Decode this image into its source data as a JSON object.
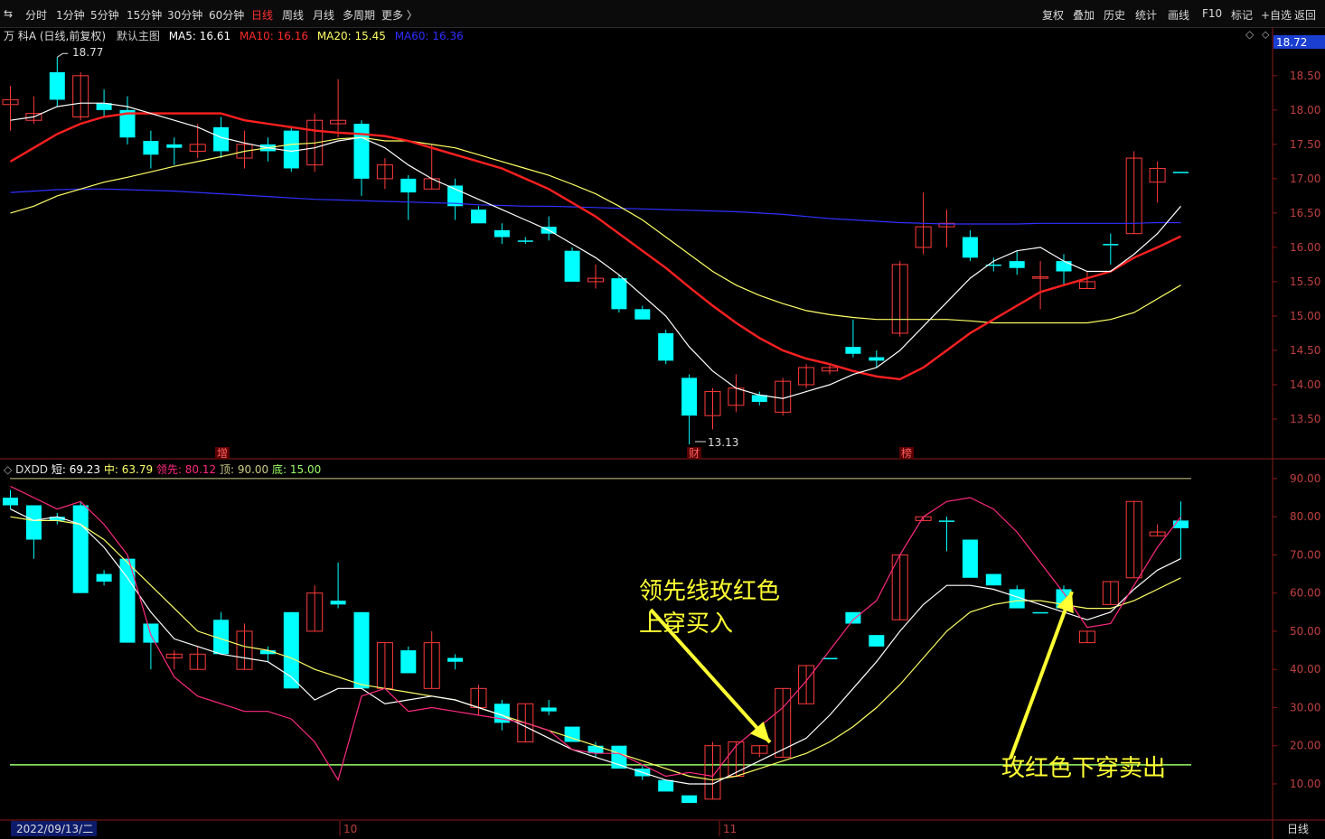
{
  "toolbar": {
    "back_arrow": "⇆",
    "periods": [
      "分时",
      "1分钟",
      "5分钟",
      "15分钟",
      "30分钟",
      "60分钟",
      "日线",
      "周线",
      "月线",
      "多周期",
      "更多 〉"
    ],
    "active_period": "日线",
    "right_items": [
      "复权",
      "叠加",
      "历史",
      "统计",
      "画线",
      "F10",
      "标记",
      "+自选",
      "返回"
    ]
  },
  "main_info": {
    "stock": "万 科A (日线,前复权)",
    "template": "默认主图",
    "ma5": "MA5: 16.61",
    "ma10": "MA10: 16.16",
    "ma20": "MA20: 15.45",
    "ma60": "MA60: 16.36",
    "current_price": "18.72",
    "diamond": "◇",
    "corner": "⬦"
  },
  "sub_info": {
    "name": "DXDD",
    "short": "短: 69.23",
    "mid": "中: 63.79",
    "lead": "领先: 80.12",
    "top": "顶: 90.00",
    "bottom": "底: 15.00"
  },
  "annotations": {
    "buy_line1": "领先线玫红色",
    "buy_line2": "上穿买入",
    "sell": "玫红色下穿卖出",
    "high_label": "18.77",
    "low_label": "13.13",
    "marks": [
      "增",
      "财",
      "榜"
    ]
  },
  "footer": {
    "date": "2022/09/13/二",
    "month_a": "10",
    "month_b": "11",
    "period_label": "日线"
  },
  "colors": {
    "up": "#ff3b3b",
    "down": "#00ffff",
    "ma5": "#ffffff",
    "ma10": "#ff2020",
    "ma20": "#ffff66",
    "ma60": "#3030ff",
    "lead": "#ff2a7f",
    "short": "#ffffff",
    "mid": "#ffff66",
    "bottom_line": "#99ff66",
    "top_line": "#cccc88",
    "annotation": "#ffff33"
  },
  "chart_data": [
    {
      "type": "candlestick",
      "title": "万 科A (日线,前复权)",
      "y_ticks": [
        18.5,
        18.0,
        17.5,
        17.0,
        16.5,
        16.0,
        15.5,
        15.0,
        14.5,
        14.0,
        13.5
      ],
      "y_tick_labels": [
        "18.50",
        "18.00",
        "17.50",
        "17.00",
        "16.50",
        "16.00",
        "15.50",
        "15.00",
        "14.50",
        "14.00",
        "13.50"
      ],
      "ylim": [
        13.0,
        19.05
      ],
      "candles": [
        [
          18.08,
          18.15,
          18.35,
          17.7
        ],
        [
          17.85,
          17.95,
          18.2,
          17.8
        ],
        [
          18.55,
          18.15,
          18.77,
          18.05
        ],
        [
          17.9,
          18.5,
          18.55,
          17.85
        ],
        [
          18.1,
          18.0,
          18.3,
          17.9
        ],
        [
          18.0,
          17.6,
          18.2,
          17.5
        ],
        [
          17.55,
          17.35,
          17.7,
          17.15
        ],
        [
          17.5,
          17.45,
          17.6,
          17.2
        ],
        [
          17.4,
          17.5,
          17.8,
          17.3
        ],
        [
          17.75,
          17.4,
          17.9,
          17.3
        ],
        [
          17.3,
          17.5,
          17.7,
          17.15
        ],
        [
          17.5,
          17.4,
          17.6,
          17.25
        ],
        [
          17.7,
          17.15,
          17.75,
          17.1
        ],
        [
          17.2,
          17.85,
          17.95,
          17.1
        ],
        [
          17.8,
          17.85,
          18.45,
          17.6
        ],
        [
          17.8,
          17.0,
          17.85,
          16.75
        ],
        [
          17.0,
          17.2,
          17.3,
          16.85
        ],
        [
          17.0,
          16.8,
          17.05,
          16.4
        ],
        [
          16.85,
          17.0,
          17.5,
          16.85
        ],
        [
          16.9,
          16.6,
          17.0,
          16.4
        ],
        [
          16.55,
          16.35,
          16.6,
          16.35
        ],
        [
          16.25,
          16.15,
          16.35,
          16.05
        ],
        [
          16.1,
          16.1,
          16.15,
          16.05
        ],
        [
          16.3,
          16.2,
          16.45,
          16.1
        ],
        [
          15.95,
          15.5,
          16.0,
          15.5
        ],
        [
          15.5,
          15.55,
          15.75,
          15.4
        ],
        [
          15.55,
          15.1,
          15.6,
          15.05
        ],
        [
          15.1,
          14.95,
          15.15,
          14.95
        ],
        [
          14.75,
          14.35,
          14.8,
          14.3
        ],
        [
          14.1,
          13.55,
          14.15,
          13.13
        ],
        [
          13.55,
          13.9,
          13.95,
          13.35
        ],
        [
          13.7,
          13.95,
          14.15,
          13.6
        ],
        [
          13.85,
          13.75,
          13.9,
          13.7
        ],
        [
          13.6,
          14.05,
          14.1,
          13.55
        ],
        [
          14.0,
          14.25,
          14.3,
          13.95
        ],
        [
          14.2,
          14.25,
          14.3,
          14.15
        ],
        [
          14.55,
          14.45,
          14.95,
          14.4
        ],
        [
          14.4,
          14.35,
          14.5,
          14.25
        ],
        [
          14.75,
          15.75,
          15.8,
          14.7
        ],
        [
          16.0,
          16.3,
          16.8,
          15.9
        ],
        [
          16.3,
          16.35,
          16.55,
          16.0
        ],
        [
          16.15,
          15.85,
          16.25,
          15.8
        ],
        [
          15.75,
          15.75,
          15.85,
          15.65
        ],
        [
          15.8,
          15.7,
          15.95,
          15.6
        ],
        [
          15.55,
          15.57,
          15.8,
          15.1
        ],
        [
          15.8,
          15.65,
          15.9,
          15.45
        ],
        [
          15.4,
          15.5,
          15.65,
          15.4
        ],
        [
          16.05,
          16.05,
          16.2,
          15.75
        ],
        [
          16.2,
          17.3,
          17.4,
          16.2
        ],
        [
          16.95,
          17.15,
          17.25,
          16.65
        ],
        [
          17.1,
          17.1,
          17.1,
          17.1
        ]
      ],
      "ma5": [
        17.85,
        17.9,
        18.05,
        18.1,
        18.1,
        18.05,
        17.95,
        17.85,
        17.75,
        17.6,
        17.52,
        17.45,
        17.4,
        17.45,
        17.55,
        17.6,
        17.45,
        17.2,
        17.0,
        16.85,
        16.7,
        16.55,
        16.4,
        16.25,
        16.05,
        15.85,
        15.6,
        15.3,
        15.0,
        14.55,
        14.2,
        13.95,
        13.85,
        13.8,
        13.9,
        14.0,
        14.15,
        14.25,
        14.5,
        14.85,
        15.2,
        15.55,
        15.8,
        15.95,
        16.0,
        15.8,
        15.65,
        15.65,
        15.9,
        16.2,
        16.6
      ],
      "ma10": [
        17.25,
        17.45,
        17.65,
        17.8,
        17.9,
        17.95,
        17.95,
        17.95,
        17.95,
        17.95,
        17.85,
        17.8,
        17.75,
        17.7,
        17.67,
        17.65,
        17.62,
        17.55,
        17.45,
        17.35,
        17.25,
        17.15,
        17.0,
        16.85,
        16.65,
        16.45,
        16.2,
        15.95,
        15.7,
        15.42,
        15.15,
        14.9,
        14.68,
        14.5,
        14.38,
        14.3,
        14.2,
        14.12,
        14.08,
        14.25,
        14.5,
        14.75,
        14.95,
        15.15,
        15.35,
        15.45,
        15.55,
        15.65,
        15.85,
        16.0,
        16.16
      ],
      "ma20": [
        16.5,
        16.6,
        16.75,
        16.85,
        16.95,
        17.02,
        17.1,
        17.18,
        17.25,
        17.32,
        17.4,
        17.45,
        17.5,
        17.52,
        17.58,
        17.6,
        17.55,
        17.55,
        17.5,
        17.45,
        17.35,
        17.25,
        17.15,
        17.05,
        16.92,
        16.78,
        16.6,
        16.4,
        16.15,
        15.9,
        15.65,
        15.45,
        15.3,
        15.18,
        15.08,
        15.02,
        14.98,
        14.95,
        14.95,
        14.95,
        14.95,
        14.93,
        14.9,
        14.9,
        14.9,
        14.9,
        14.9,
        14.95,
        15.05,
        15.25,
        15.45
      ],
      "ma60": [
        16.8,
        16.82,
        16.84,
        16.85,
        16.85,
        16.84,
        16.83,
        16.82,
        16.8,
        16.78,
        16.76,
        16.74,
        16.72,
        16.7,
        16.69,
        16.68,
        16.67,
        16.66,
        16.65,
        16.64,
        16.62,
        16.61,
        16.6,
        16.6,
        16.59,
        16.58,
        16.57,
        16.56,
        16.55,
        16.54,
        16.53,
        16.52,
        16.5,
        16.48,
        16.45,
        16.42,
        16.4,
        16.38,
        16.36,
        16.35,
        16.34,
        16.34,
        16.34,
        16.34,
        16.35,
        16.35,
        16.35,
        16.35,
        16.35,
        16.36,
        16.36
      ]
    },
    {
      "type": "candlestick",
      "title": "DXDD",
      "y_ticks": [
        90,
        80,
        70,
        60,
        50,
        40,
        30,
        20,
        10
      ],
      "y_tick_labels": [
        "90.00",
        "80.00",
        "70.00",
        "60.00",
        "50.00",
        "40.00",
        "30.00",
        "20.00",
        "10.00"
      ],
      "ylim": [
        1,
        94
      ],
      "top_line": 90,
      "bottom_line": 15,
      "candles": [
        [
          85,
          83,
          87,
          82
        ],
        [
          83,
          74,
          82,
          69
        ],
        [
          80,
          79,
          81,
          78
        ],
        [
          83,
          60,
          84,
          60
        ],
        [
          65,
          63,
          66,
          62
        ],
        [
          69,
          47,
          69,
          47
        ],
        [
          52,
          47,
          52,
          40
        ],
        [
          43,
          44,
          45,
          40
        ],
        [
          40,
          44,
          46,
          40
        ],
        [
          53,
          44,
          55,
          44
        ],
        [
          40,
          50,
          52,
          40
        ],
        [
          45,
          44,
          46,
          42
        ],
        [
          55,
          35,
          55,
          35
        ],
        [
          50,
          60,
          62,
          50
        ],
        [
          58,
          57,
          68,
          56
        ],
        [
          55,
          35,
          55,
          35
        ],
        [
          35,
          47,
          47,
          35
        ],
        [
          45,
          39,
          46,
          39
        ],
        [
          35,
          47,
          50,
          35
        ],
        [
          43,
          42,
          44,
          40
        ],
        [
          30,
          35,
          36,
          28
        ],
        [
          31,
          26,
          32,
          24
        ],
        [
          21,
          31,
          31,
          21
        ],
        [
          30,
          29,
          32,
          28
        ],
        [
          25,
          21,
          25,
          21
        ],
        [
          20,
          18,
          21,
          17
        ],
        [
          20,
          14,
          20,
          14
        ],
        [
          14,
          12,
          15,
          11
        ],
        [
          11,
          8,
          11,
          8
        ],
        [
          7,
          5,
          7,
          5
        ],
        [
          6,
          20,
          21,
          6
        ],
        [
          12,
          21,
          21,
          12
        ],
        [
          18,
          20,
          20,
          17
        ],
        [
          17,
          35,
          35,
          17
        ],
        [
          31,
          41,
          41,
          31
        ],
        [
          43,
          43,
          43,
          43
        ],
        [
          55,
          52,
          55,
          52
        ],
        [
          49,
          46,
          49,
          46
        ],
        [
          53,
          70,
          70,
          53
        ],
        [
          79,
          80,
          80,
          79
        ],
        [
          79,
          79,
          80,
          71
        ],
        [
          74,
          64,
          74,
          64
        ],
        [
          65,
          62,
          65,
          62
        ],
        [
          61,
          56,
          62,
          56
        ],
        [
          55,
          55,
          55,
          55
        ],
        [
          61,
          56,
          62,
          56
        ],
        [
          47,
          50,
          50,
          47
        ],
        [
          57,
          63,
          63,
          57
        ],
        [
          64,
          84,
          84,
          64
        ],
        [
          75,
          76,
          78,
          75
        ],
        [
          79,
          77,
          84,
          69
        ]
      ],
      "lead": [
        88,
        85,
        82,
        84,
        78,
        70,
        49,
        38,
        33,
        31,
        29,
        29,
        27,
        21,
        11,
        33,
        35,
        29,
        30,
        29,
        28,
        27,
        26,
        24,
        19,
        18,
        18,
        15,
        12,
        13,
        12,
        20,
        25,
        30,
        37,
        45,
        53,
        58,
        70,
        80,
        84,
        85,
        82,
        76,
        68,
        60,
        51,
        52,
        62,
        72,
        80
      ],
      "short": [
        82,
        79,
        80,
        78,
        72,
        64,
        55,
        48,
        46,
        44,
        43,
        42,
        38,
        32,
        35,
        35,
        31,
        32,
        33,
        32,
        30,
        28,
        25,
        22,
        19,
        17,
        15,
        13,
        11,
        10,
        10,
        13,
        16,
        19,
        22,
        28,
        35,
        42,
        50,
        57,
        62,
        62,
        61,
        59,
        57,
        55,
        53,
        55,
        61,
        66,
        69
      ],
      "mid": [
        80,
        79,
        79,
        78,
        74,
        68,
        62,
        56,
        50,
        48,
        46,
        45,
        43,
        40,
        38,
        36,
        35,
        34,
        33,
        32,
        30,
        28,
        26,
        24,
        22,
        20,
        18,
        16,
        14,
        12,
        11,
        12,
        14,
        16,
        18,
        21,
        25,
        30,
        36,
        43,
        50,
        55,
        57,
        58,
        58,
        57,
        56,
        56,
        58,
        61,
        64
      ]
    }
  ]
}
